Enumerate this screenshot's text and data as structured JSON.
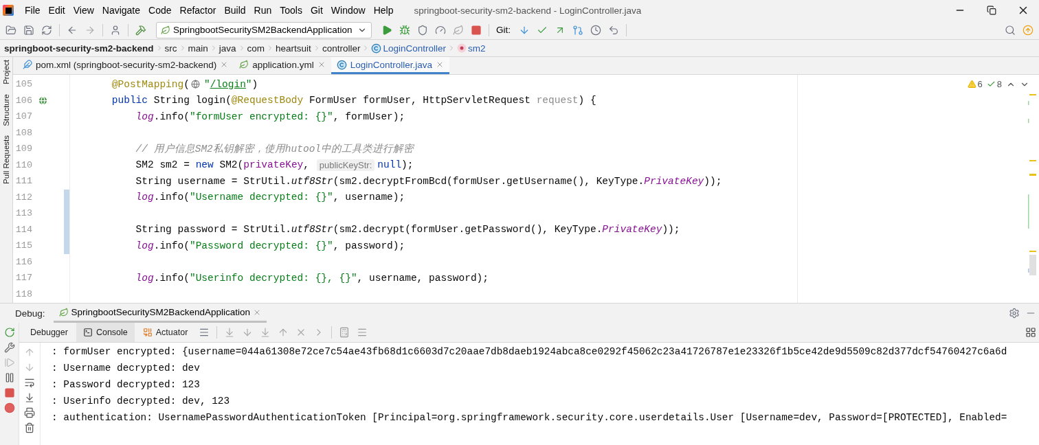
{
  "window": {
    "title": "springboot-security-sm2-backend - LoginController.java"
  },
  "menu": [
    "File",
    "Edit",
    "View",
    "Navigate",
    "Code",
    "Refactor",
    "Build",
    "Run",
    "Tools",
    "Git",
    "Window",
    "Help"
  ],
  "toolbar": {
    "run_configuration": "SpringbootSecuritySM2BackendApplication",
    "vcs_label": "Git:"
  },
  "breadcrumbs": [
    {
      "kind": "project",
      "label": "springboot-security-sm2-backend"
    },
    {
      "kind": "folder",
      "label": "src"
    },
    {
      "kind": "folder",
      "label": "main"
    },
    {
      "kind": "folder",
      "label": "java"
    },
    {
      "kind": "folder",
      "label": "com"
    },
    {
      "kind": "folder",
      "label": "heartsuit"
    },
    {
      "kind": "folder",
      "label": "controller"
    },
    {
      "kind": "class",
      "label": "LoginController"
    },
    {
      "kind": "method",
      "label": "sm2"
    }
  ],
  "side_tools": [
    "Project",
    "Structure",
    "Pull Requests"
  ],
  "tabs": [
    {
      "kind": "maven",
      "label": "pom.xml (springboot-security-sm2-backend)",
      "selected": false
    },
    {
      "kind": "yaml",
      "label": "application.yml",
      "selected": false
    },
    {
      "kind": "class",
      "label": "LoginController.java",
      "selected": true
    }
  ],
  "inspections": {
    "warnings": "6",
    "typos": "8"
  },
  "editor": {
    "lines": [
      {
        "number": "105",
        "changed": false,
        "endpoint_marker": false,
        "tokens": [
          {
            "kind": "annot",
            "text": "    @PostMapping"
          },
          {
            "kind": "plain",
            "text": "("
          },
          {
            "kind": "icon"
          },
          {
            "kind": "str",
            "text": "\""
          },
          {
            "kind": "link",
            "text": "/login"
          },
          {
            "kind": "str",
            "text": "\""
          },
          {
            "kind": "plain",
            "text": ")"
          }
        ]
      },
      {
        "number": "106",
        "changed": false,
        "endpoint_marker": true,
        "tokens": [
          {
            "kind": "kw",
            "text": "    public "
          },
          {
            "kind": "plain",
            "text": "String login("
          },
          {
            "kind": "annot",
            "text": "@RequestBody"
          },
          {
            "kind": "plain",
            "text": " FormUser formUser, HttpServletRequest "
          },
          {
            "kind": "unused",
            "text": "request"
          },
          {
            "kind": "plain",
            "text": ") {"
          }
        ]
      },
      {
        "number": "107",
        "changed": false,
        "endpoint_marker": false,
        "tokens": [
          {
            "kind": "sfield",
            "text": "        log"
          },
          {
            "kind": "plain",
            "text": ".info("
          },
          {
            "kind": "str",
            "text": "\"formUser encrypted: {}\""
          },
          {
            "kind": "plain",
            "text": ", formUser);"
          }
        ]
      },
      {
        "number": "108",
        "changed": false,
        "endpoint_marker": false
      },
      {
        "number": "109",
        "changed": false,
        "endpoint_marker": false,
        "tokens": [
          {
            "kind": "comment",
            "text": "        // 用户信息SM2私钥解密，使用hutool中的工具类进行解密"
          }
        ]
      },
      {
        "number": "110",
        "changed": false,
        "endpoint_marker": false,
        "tokens": [
          {
            "kind": "plain",
            "text": "        SM2 sm2 = "
          },
          {
            "kind": "kw",
            "text": "new "
          },
          {
            "kind": "plain",
            "text": "SM2("
          },
          {
            "kind": "field",
            "text": "privateKey"
          },
          {
            "kind": "plain",
            "text": ", "
          },
          {
            "kind": "hint",
            "text": "publicKeyStr:"
          },
          {
            "kind": "kw",
            "text": "null"
          },
          {
            "kind": "plain",
            "text": ");"
          }
        ]
      },
      {
        "number": "111",
        "changed": false,
        "endpoint_marker": false,
        "tokens": [
          {
            "kind": "plain",
            "text": "        String username = StrUtil."
          },
          {
            "kind": "static",
            "text": "utf8Str"
          },
          {
            "kind": "plain",
            "text": "(sm2.decryptFromBcd(formUser.getUsername(), KeyType."
          },
          {
            "kind": "sfield",
            "text": "PrivateKey"
          },
          {
            "kind": "plain",
            "text": "));"
          }
        ]
      },
      {
        "number": "112",
        "changed": true,
        "endpoint_marker": false,
        "tokens": [
          {
            "kind": "sfield",
            "text": "        log"
          },
          {
            "kind": "plain",
            "text": ".info("
          },
          {
            "kind": "str",
            "text": "\"Username decrypted: {}\""
          },
          {
            "kind": "plain",
            "text": ", username);"
          }
        ]
      },
      {
        "number": "113",
        "changed": true,
        "endpoint_marker": false
      },
      {
        "number": "114",
        "changed": true,
        "endpoint_marker": false,
        "tokens": [
          {
            "kind": "plain",
            "text": "        String password = StrUtil."
          },
          {
            "kind": "static",
            "text": "utf8Str"
          },
          {
            "kind": "plain",
            "text": "(sm2.decrypt(formUser.getPassword(), KeyType."
          },
          {
            "kind": "sfield",
            "text": "PrivateKey"
          },
          {
            "kind": "plain",
            "text": "));"
          }
        ]
      },
      {
        "number": "115",
        "changed": true,
        "endpoint_marker": false,
        "tokens": [
          {
            "kind": "sfield",
            "text": "        log"
          },
          {
            "kind": "plain",
            "text": ".info("
          },
          {
            "kind": "str",
            "text": "\"Password decrypted: {}\""
          },
          {
            "kind": "plain",
            "text": ", password);"
          }
        ]
      },
      {
        "number": "116",
        "changed": false,
        "endpoint_marker": false
      },
      {
        "number": "117",
        "changed": false,
        "endpoint_marker": false,
        "tokens": [
          {
            "kind": "sfield",
            "text": "        log"
          },
          {
            "kind": "plain",
            "text": ".info("
          },
          {
            "kind": "str",
            "text": "\"Userinfo decrypted: {}, {}\""
          },
          {
            "kind": "plain",
            "text": ", username, password);"
          }
        ]
      },
      {
        "number": "118",
        "changed": false,
        "endpoint_marker": false
      }
    ]
  },
  "debug": {
    "label": "Debug:",
    "session": "SpringbootSecuritySM2BackendApplication",
    "tabs": [
      {
        "kind": "debugger",
        "label": "Debugger",
        "selected": false
      },
      {
        "kind": "console",
        "label": "Console",
        "selected": true
      },
      {
        "kind": "actuator",
        "label": "Actuator",
        "selected": false
      }
    ],
    "console": [
      ": formUser encrypted: {username=044a61308e72ce7c54ae43fb68d1c6603d7c20aae7db8daeb1924abca8ce0292f45062c23a41726787e1e23326f1b5ce42de9d5509c82d377dcf54760427c6a6d",
      ": Username decrypted: dev",
      ": Password decrypted: 123",
      ": Userinfo decrypted: dev, 123",
      ": authentication: UsernamePasswordAuthenticationToken [Principal=org.springframework.security.core.userdetails.User [Username=dev, Password=[PROTECTED], Enabled="
    ]
  }
}
